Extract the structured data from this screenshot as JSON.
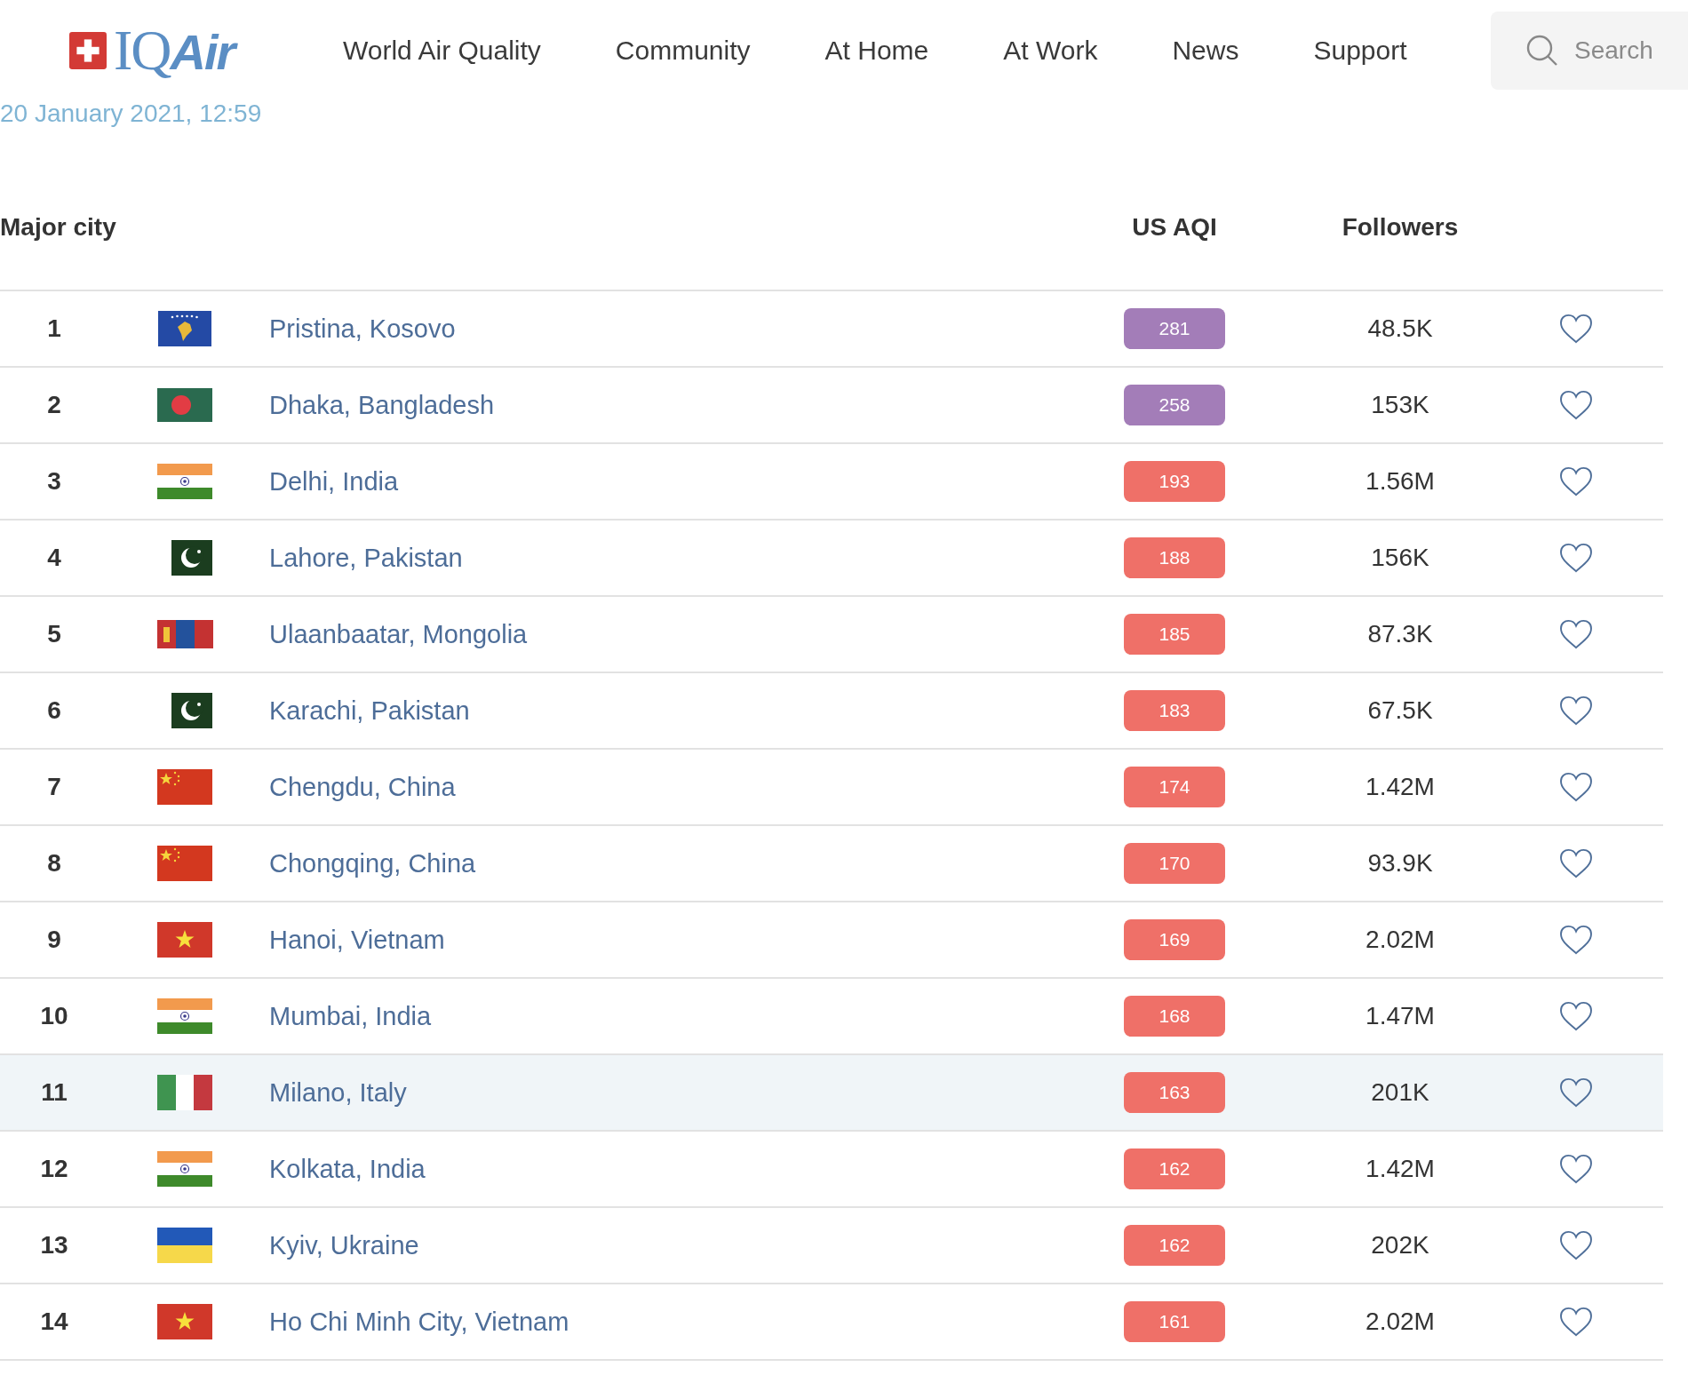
{
  "logo": {
    "prefix": "IQ",
    "suffix": "Air"
  },
  "nav": [
    "World Air Quality",
    "Community",
    "At Home",
    "At Work",
    "News",
    "Support"
  ],
  "search": {
    "placeholder": "Search"
  },
  "timestamp": "20 January 2021, 12:59",
  "table": {
    "columns": [
      "Major city",
      "US AQI",
      "Followers"
    ],
    "rows": [
      {
        "rank": "1",
        "kind": "kosovo",
        "city": "Pristina, Kosovo",
        "aqi": "281",
        "color": "#a37db8",
        "followers": "48.5K",
        "highlighted": false,
        "favorite": false
      },
      {
        "rank": "2",
        "kind": "bangladesh",
        "city": "Dhaka, Bangladesh",
        "aqi": "258",
        "color": "#a37db8",
        "followers": "153K",
        "highlighted": false,
        "favorite": false
      },
      {
        "rank": "3",
        "kind": "india",
        "city": "Delhi, India",
        "aqi": "193",
        "color": "#ef7068",
        "followers": "1.56M",
        "highlighted": false,
        "favorite": false
      },
      {
        "rank": "4",
        "kind": "pakistan",
        "city": "Lahore, Pakistan",
        "aqi": "188",
        "color": "#ef7068",
        "followers": "156K",
        "highlighted": false,
        "favorite": false
      },
      {
        "rank": "5",
        "kind": "mongolia",
        "city": "Ulaanbaatar, Mongolia",
        "aqi": "185",
        "color": "#ef7068",
        "followers": "87.3K",
        "highlighted": false,
        "favorite": false
      },
      {
        "rank": "6",
        "kind": "pakistan",
        "city": "Karachi, Pakistan",
        "aqi": "183",
        "color": "#ef7068",
        "followers": "67.5K",
        "highlighted": false,
        "favorite": false
      },
      {
        "rank": "7",
        "kind": "china",
        "city": "Chengdu, China",
        "aqi": "174",
        "color": "#ef7068",
        "followers": "1.42M",
        "highlighted": false,
        "favorite": false
      },
      {
        "rank": "8",
        "kind": "china",
        "city": "Chongqing, China",
        "aqi": "170",
        "color": "#ef7068",
        "followers": "93.9K",
        "highlighted": false,
        "favorite": false
      },
      {
        "rank": "9",
        "kind": "vietnam",
        "city": "Hanoi, Vietnam",
        "aqi": "169",
        "color": "#ef7068",
        "followers": "2.02M",
        "highlighted": false,
        "favorite": false
      },
      {
        "rank": "10",
        "kind": "india",
        "city": "Mumbai, India",
        "aqi": "168",
        "color": "#ef7068",
        "followers": "1.47M",
        "highlighted": false,
        "favorite": false
      },
      {
        "rank": "11",
        "kind": "italy",
        "city": "Milano, Italy",
        "aqi": "163",
        "color": "#ef7068",
        "followers": "201K",
        "highlighted": true,
        "favorite": false
      },
      {
        "rank": "12",
        "kind": "india",
        "city": "Kolkata, India",
        "aqi": "162",
        "color": "#ef7068",
        "followers": "1.42M",
        "highlighted": false,
        "favorite": false
      },
      {
        "rank": "13",
        "kind": "ukraine",
        "city": "Kyiv, Ukraine",
        "aqi": "162",
        "color": "#ef7068",
        "followers": "202K",
        "highlighted": false,
        "favorite": false
      },
      {
        "rank": "14",
        "kind": "vietnam",
        "city": "Ho Chi Minh City, Vietnam",
        "aqi": "161",
        "color": "#ef7068",
        "followers": "2.02M",
        "highlighted": false,
        "favorite": false
      }
    ]
  }
}
